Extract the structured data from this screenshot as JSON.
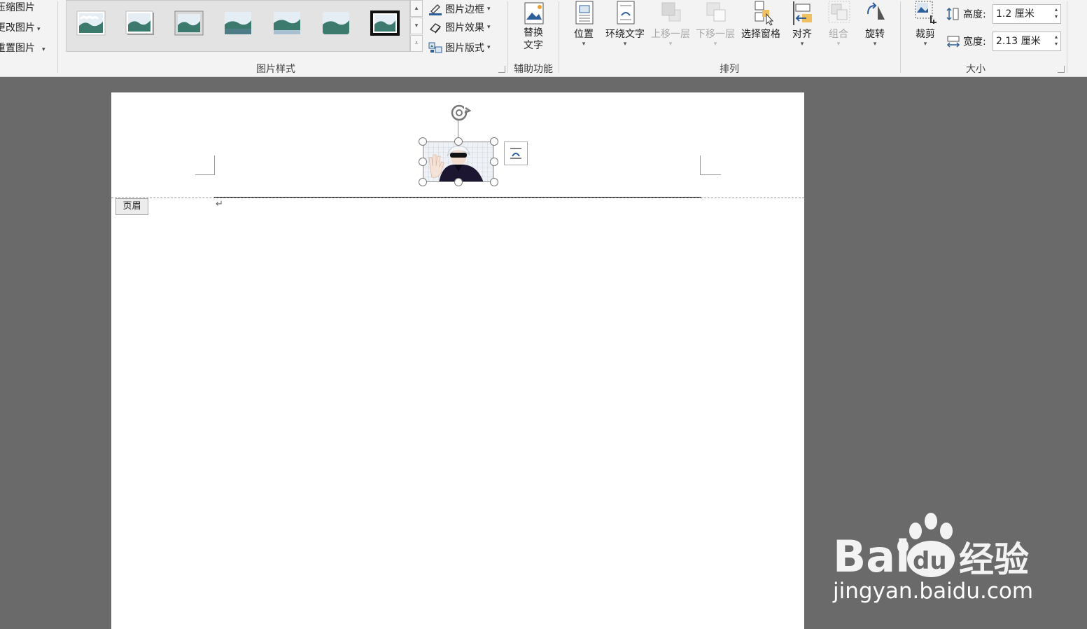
{
  "ribbon": {
    "adjust": {
      "items": [
        {
          "label": "压缩图片"
        },
        {
          "label": "更改图片"
        },
        {
          "label": "重置图片"
        }
      ]
    },
    "picture_styles": {
      "group_label": "图片样式",
      "commands": [
        {
          "label": "图片边框",
          "icon": "pen-border-icon"
        },
        {
          "label": "图片效果",
          "icon": "effects-icon"
        },
        {
          "label": "图片版式",
          "icon": "smartart-layout-icon"
        }
      ]
    },
    "accessibility": {
      "group_label": "辅助功能",
      "alt_text": {
        "line1": "替换",
        "line2": "文字"
      }
    },
    "arrange": {
      "group_label": "排列",
      "buttons": [
        {
          "label": "位置",
          "enabled": true
        },
        {
          "label": "环绕文字",
          "enabled": true
        },
        {
          "label": "上移一层",
          "enabled": false
        },
        {
          "label": "下移一层",
          "enabled": false
        },
        {
          "label": "选择窗格",
          "enabled": true
        },
        {
          "label": "对齐",
          "enabled": true
        },
        {
          "label": "组合",
          "enabled": false
        },
        {
          "label": "旋转",
          "enabled": true
        }
      ]
    },
    "size": {
      "group_label": "大小",
      "crop_label": "裁剪",
      "height_label": "高度:",
      "height_value": "1.2 厘米",
      "width_label": "宽度:",
      "width_value": "2.13 厘米"
    }
  },
  "document": {
    "header_tag": "页眉",
    "paragraph_mark": "↵"
  },
  "watermark": {
    "url": "jingyan.baidu.com",
    "logo_text": "Bai du 经验"
  },
  "colors": {
    "ribbon_bg": "#f3f3f3",
    "workspace_bg": "#6a6a6a",
    "accent_blue": "#2e5f9b"
  }
}
